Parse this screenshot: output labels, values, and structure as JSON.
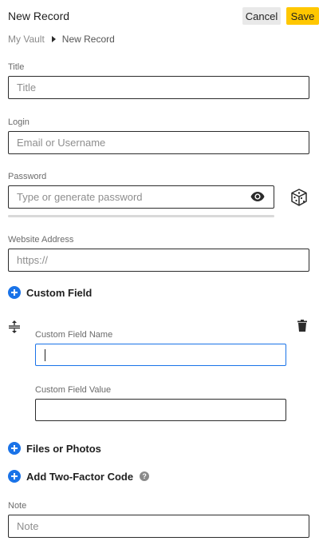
{
  "header": {
    "title": "New Record",
    "cancel_label": "Cancel",
    "save_label": "Save"
  },
  "breadcrumb": {
    "root": "My Vault",
    "current": "New Record"
  },
  "fields": {
    "title": {
      "label": "Title",
      "placeholder": "Title",
      "value": ""
    },
    "login": {
      "label": "Login",
      "placeholder": "Email or Username",
      "value": ""
    },
    "password": {
      "label": "Password",
      "placeholder": "Type or generate password",
      "value": ""
    },
    "website": {
      "label": "Website Address",
      "placeholder": "https://",
      "value": ""
    },
    "note": {
      "label": "Note",
      "placeholder": "Note",
      "value": ""
    }
  },
  "custom_field": {
    "add_label": "Custom Field",
    "name_label": "Custom Field Name",
    "value_label": "Custom Field Value"
  },
  "actions": {
    "files_label": "Files or Photos",
    "two_factor_label": "Add Two-Factor Code",
    "help_glyph": "?"
  },
  "icons": {
    "eye": "eye-icon",
    "dice": "dice-icon",
    "plus": "plus-circle-icon",
    "drag": "drag-handle-icon",
    "trash": "trash-icon",
    "help": "help-icon"
  },
  "colors": {
    "accent": "#1a73e8",
    "save": "#ffc700",
    "cancel": "#e9e9e9"
  }
}
